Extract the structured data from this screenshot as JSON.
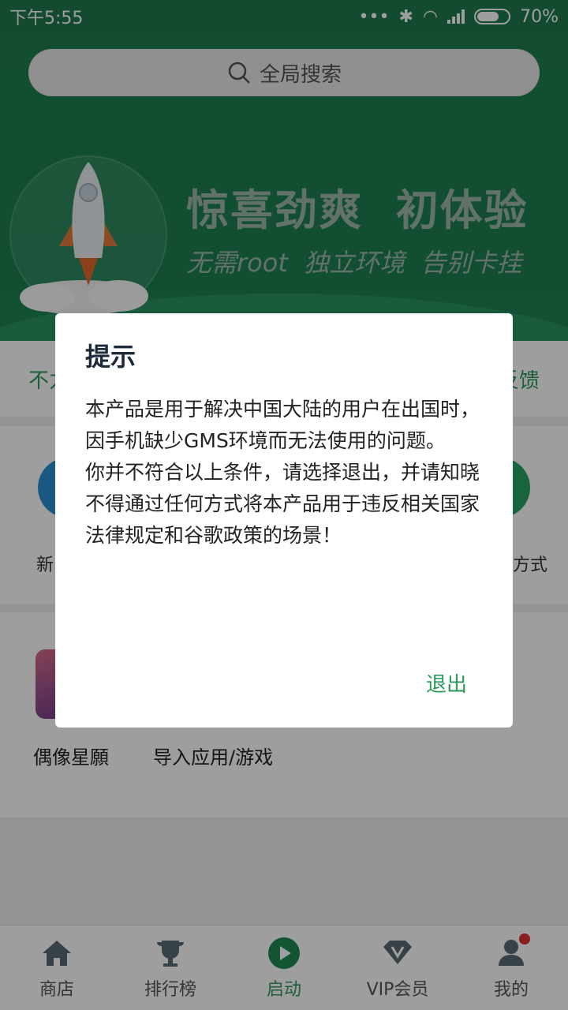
{
  "status_bar": {
    "time": "下午5:55",
    "battery": "70%",
    "battery_level": 0.7
  },
  "search": {
    "placeholder": "全局搜索"
  },
  "hero": {
    "title": "惊喜劲爽  初体验",
    "subtitle": "无需root  独立环境  告别卡挂"
  },
  "notice_strip": {
    "left_partial": "不力",
    "right_partial": "反馈"
  },
  "features": [
    {
      "label": "新",
      "color": "#2a8fd0"
    },
    {
      "label": "方式",
      "color": "#27a35f"
    }
  ],
  "apps": [
    {
      "label": "偶像星願"
    },
    {
      "label": "导入应用/游戏"
    }
  ],
  "bottom_nav": [
    {
      "label": "商店",
      "icon": "home-icon"
    },
    {
      "label": "排行榜",
      "icon": "trophy-icon"
    },
    {
      "label": "启动",
      "icon": "play-icon",
      "active": true
    },
    {
      "label": "VIP会员",
      "icon": "vip-icon"
    },
    {
      "label": "我的",
      "icon": "user-icon"
    }
  ],
  "dialog": {
    "title": "提示",
    "paragraph1": "本产品是用于解决中国大陆的用户在出国时，因手机缺少GMS环境而无法使用的问题。",
    "paragraph2": "你并不符合以上条件，请选择退出，并请知晓不得通过任何方式将本产品用于违反相关国家法律规定和谷歌政策的场景！",
    "exit_label": "退出"
  },
  "colors": {
    "accent": "#2a9a5a",
    "hero_bg": "#1f7d4f"
  }
}
